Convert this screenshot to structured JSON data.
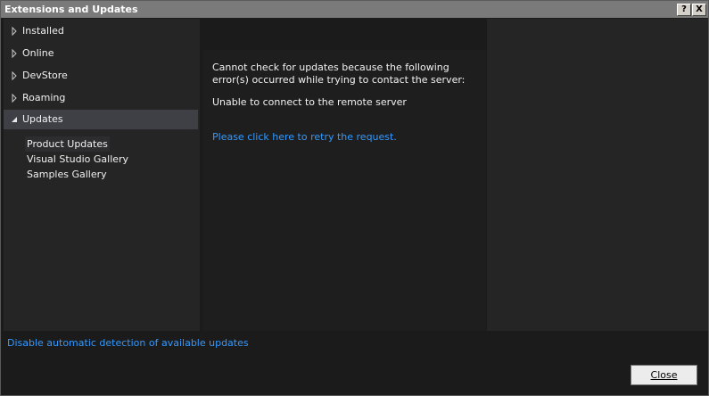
{
  "window": {
    "title": "Extensions and Updates",
    "help_label": "?",
    "close_label": "X"
  },
  "sidebar": {
    "items": [
      {
        "label": "Installed",
        "expanded": false
      },
      {
        "label": "Online",
        "expanded": false
      },
      {
        "label": "DevStore",
        "expanded": false
      },
      {
        "label": "Roaming",
        "expanded": false
      },
      {
        "label": "Updates",
        "expanded": true,
        "selected": true
      }
    ],
    "subitems": [
      {
        "label": "Product Updates",
        "selected": true
      },
      {
        "label": "Visual Studio Gallery"
      },
      {
        "label": "Samples Gallery"
      }
    ]
  },
  "content": {
    "error_message": "Cannot check for updates because the following error(s) occurred while trying to contact the server:",
    "error_detail": "Unable to connect to the remote server",
    "retry_link": "Please click here to retry the request."
  },
  "footer": {
    "disable_link": "Disable automatic detection of available updates",
    "close_button": "Close"
  },
  "colors": {
    "background": "#1b1b1c",
    "panel": "#252526",
    "link": "#3399ff",
    "selected": "#3f3f46"
  }
}
